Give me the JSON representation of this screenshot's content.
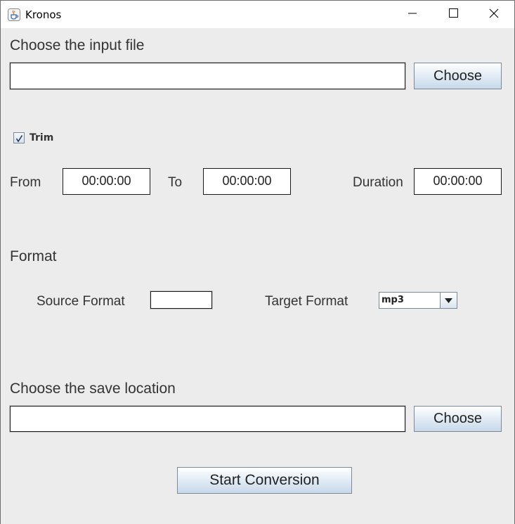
{
  "window": {
    "title": "Kronos",
    "app_icon": "java-cup-icon",
    "controls": [
      "minimize-icon",
      "maximize-icon",
      "close-icon"
    ]
  },
  "input_section": {
    "title": "Choose the input file",
    "path_value": "",
    "choose_label": "Choose"
  },
  "trim": {
    "label": "Trim",
    "checked": true,
    "from_label": "From",
    "from_value": "00:00:00",
    "to_label": "To",
    "to_value": "00:00:00",
    "duration_label": "Duration",
    "duration_value": "00:00:00"
  },
  "format": {
    "title": "Format",
    "source_label": "Source Format",
    "source_value": "",
    "target_label": "Target Format",
    "target_value": "mp3"
  },
  "save_section": {
    "title": "Choose the save location",
    "path_value": "",
    "choose_label": "Choose"
  },
  "start_button_label": "Start Conversion",
  "colors": {
    "background": "#ececec",
    "button_gradient_top": "#ffffff",
    "button_gradient_bottom": "#c8d9ea",
    "text": "#333333"
  }
}
